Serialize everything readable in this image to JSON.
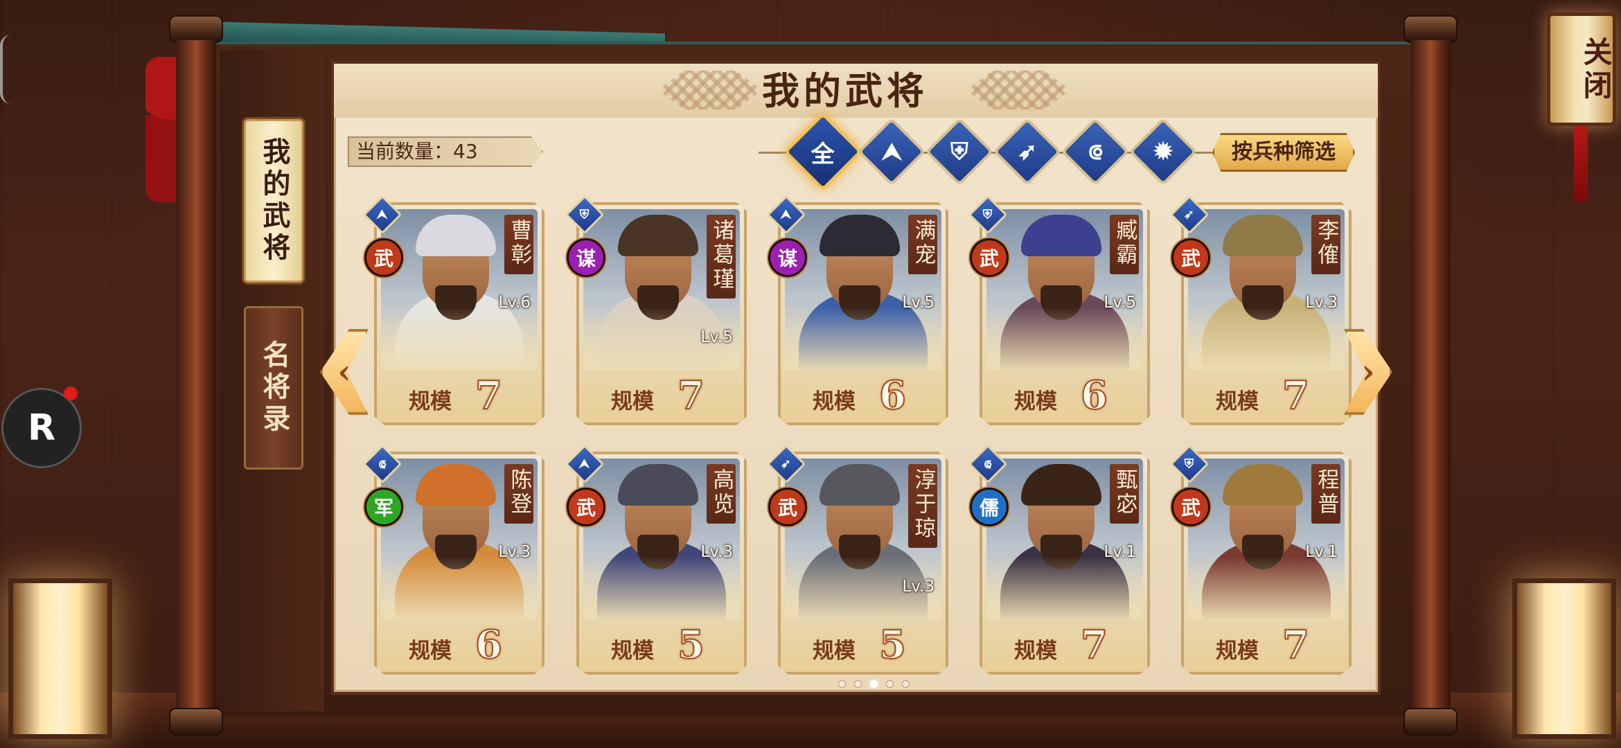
{
  "title": "我的武将",
  "side_tabs": [
    {
      "label": "我的武将",
      "active": true
    },
    {
      "label": "名将录",
      "active": false
    }
  ],
  "counter": "当前数量：43",
  "filters": [
    {
      "glyph": "全",
      "icon": "all-icon",
      "active": true
    },
    {
      "glyph": "⮝",
      "icon": "cavalry-icon",
      "active": false
    },
    {
      "glyph": "⛨",
      "icon": "shield-icon",
      "active": false
    },
    {
      "glyph": "➶",
      "icon": "spear-icon",
      "active": false
    },
    {
      "glyph": "⟃",
      "icon": "bow-icon",
      "active": false
    },
    {
      "glyph": "✹",
      "icon": "siege-icon",
      "active": false
    }
  ],
  "filter_select": "按兵种筛选",
  "close": "关闭",
  "rec_button": "R",
  "scale_label": "规模",
  "cards": [
    {
      "name": "曹彰",
      "lv": "Lv.6",
      "scale": "7",
      "role": "武",
      "role_color": "#c2381a",
      "type": "⮝",
      "hat_color": "#d9d9df",
      "body_color": "#e5e4e0"
    },
    {
      "name": "诸葛瑾",
      "lv": "Lv.5",
      "scale": "7",
      "role": "谋",
      "role_color": "#9b1fb0",
      "type": "⛨",
      "hat_color": "#4a3426",
      "body_color": "#d9cfc2"
    },
    {
      "name": "满宠",
      "lv": "Lv.5",
      "scale": "6",
      "role": "谋",
      "role_color": "#9b1fb0",
      "type": "⮝",
      "hat_color": "#2c2a33",
      "body_color": "#3d60a8"
    },
    {
      "name": "臧霸",
      "lv": "Lv.5",
      "scale": "6",
      "role": "武",
      "role_color": "#c2381a",
      "type": "⛨",
      "hat_color": "#3d3f8f",
      "body_color": "#6a4a5a"
    },
    {
      "name": "李傕",
      "lv": "Lv.3",
      "scale": "7",
      "role": "武",
      "role_color": "#c2381a",
      "type": "➶",
      "hat_color": "#8f7a48",
      "body_color": "#c9b27a"
    },
    {
      "name": "陈登",
      "lv": "Lv.3",
      "scale": "6",
      "role": "军",
      "role_color": "#2fa524",
      "type": "⟃",
      "hat_color": "#d0702a",
      "body_color": "#d38b3c"
    },
    {
      "name": "高览",
      "lv": "Lv.3",
      "scale": "5",
      "role": "武",
      "role_color": "#c2381a",
      "type": "⮝",
      "hat_color": "#4a4a58",
      "body_color": "#41477a"
    },
    {
      "name": "淳于琼",
      "lv": "Lv.3",
      "scale": "5",
      "role": "武",
      "role_color": "#c2381a",
      "type": "➶",
      "hat_color": "#56585e",
      "body_color": "#6a6e78"
    },
    {
      "name": "甄宓",
      "lv": "Lv.1",
      "scale": "7",
      "role": "儒",
      "role_color": "#1f6fc8",
      "type": "⟃",
      "hat_color": "#3a2418",
      "body_color": "#3b3246"
    },
    {
      "name": "程普",
      "lv": "Lv.1",
      "scale": "7",
      "role": "武",
      "role_color": "#c2381a",
      "type": "⛨",
      "hat_color": "#a07a3a",
      "body_color": "#7a3a30"
    }
  ],
  "pages": {
    "count": 5,
    "current": 3
  }
}
